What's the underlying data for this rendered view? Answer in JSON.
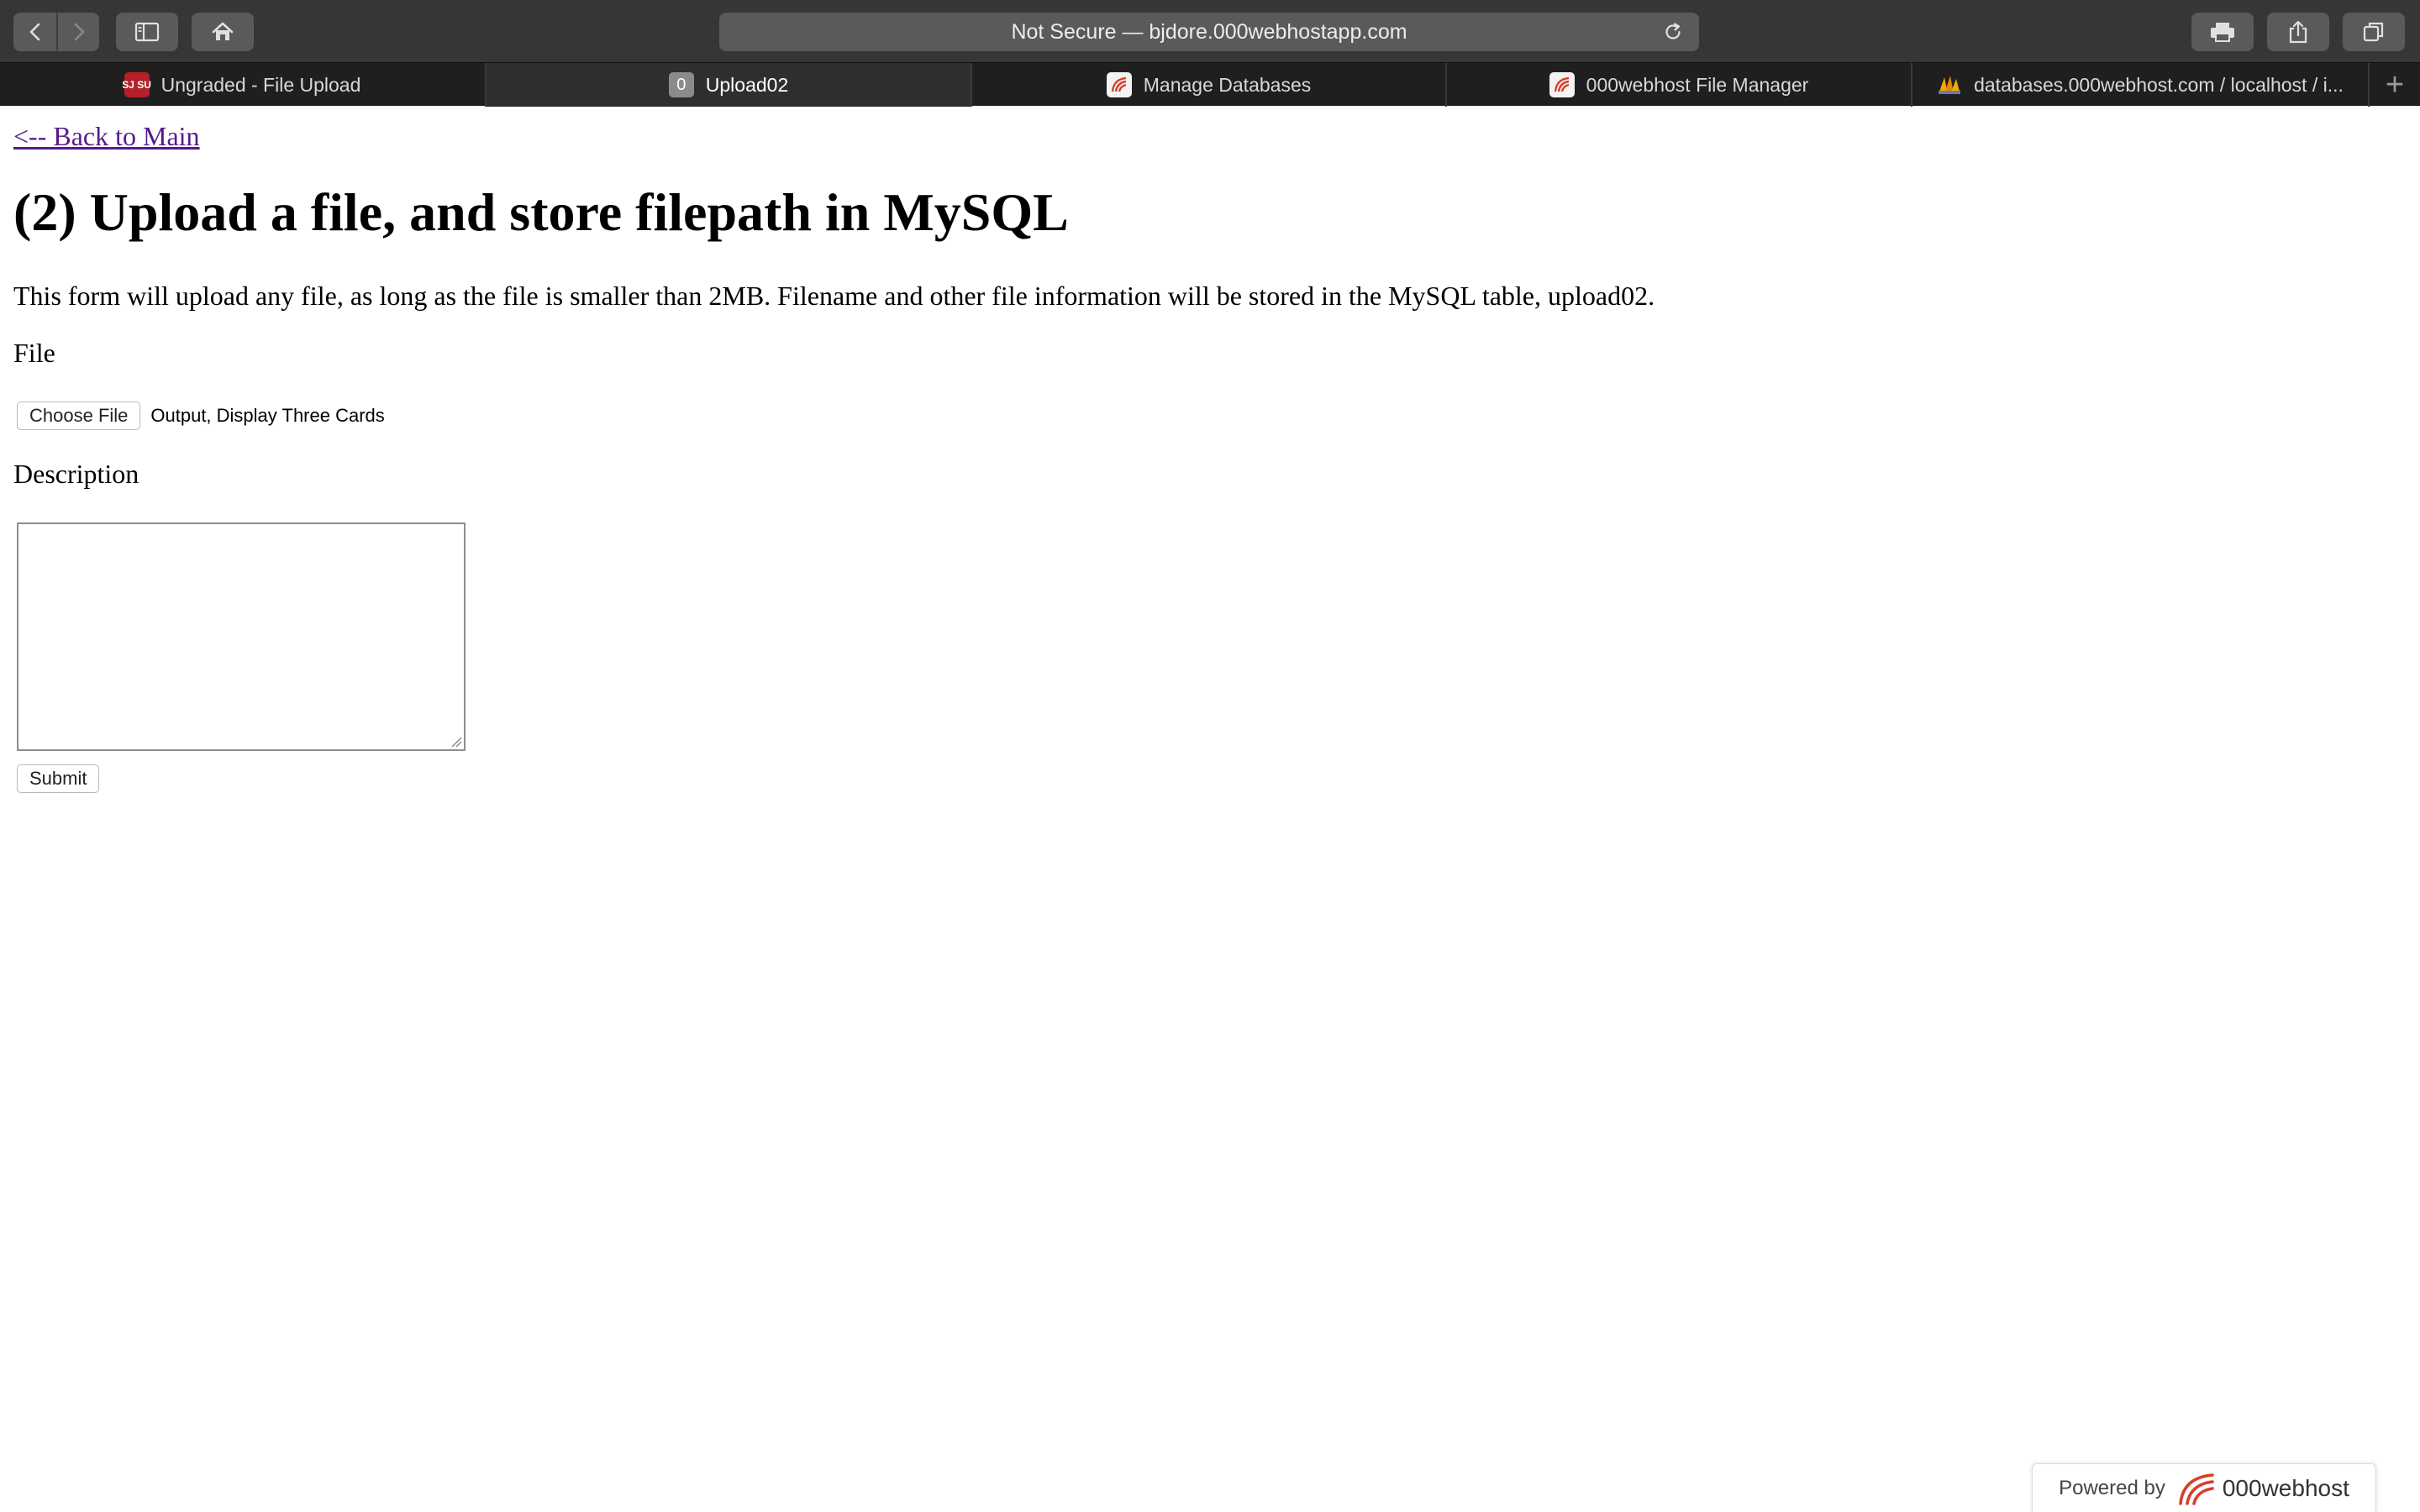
{
  "browser": {
    "address": "Not Secure — bjdore.000webhostapp.com",
    "tabs": [
      {
        "label": "Ungraded - File Upload",
        "favicon": "sjsu-icon",
        "favicon_text": "SJ SU",
        "active": false
      },
      {
        "label": "Upload02",
        "favicon": "badge-icon",
        "favicon_text": "0",
        "active": true
      },
      {
        "label": "Manage Databases",
        "favicon": "000webhost-icon",
        "active": false
      },
      {
        "label": "000webhost File Manager",
        "favicon": "000webhost-icon",
        "active": false
      },
      {
        "label": "databases.000webhost.com / localhost / i...",
        "favicon": "phpmyadmin-icon",
        "active": false
      }
    ],
    "new_tab": "+"
  },
  "page": {
    "back_link": "<-- Back to Main",
    "title": "(2) Upload a file, and store filepath in MySQL",
    "intro": "This form will upload any file, as long as the file is smaller than 2MB. Filename and other file information will be stored in the MySQL table, upload02.",
    "file_label": "File",
    "choose_file_label": "Choose File",
    "chosen_file": "Output, Display Three Cards",
    "description_label": "Description",
    "description_value": "",
    "submit_label": "Submit"
  },
  "footer": {
    "powered_by": "Powered by",
    "brand": "000webhost"
  },
  "colors": {
    "toolbar_bg": "#363636",
    "tabbar_bg": "#1f1f1f",
    "visited_link": "#551a8b",
    "brand_red": "#d6402c"
  }
}
